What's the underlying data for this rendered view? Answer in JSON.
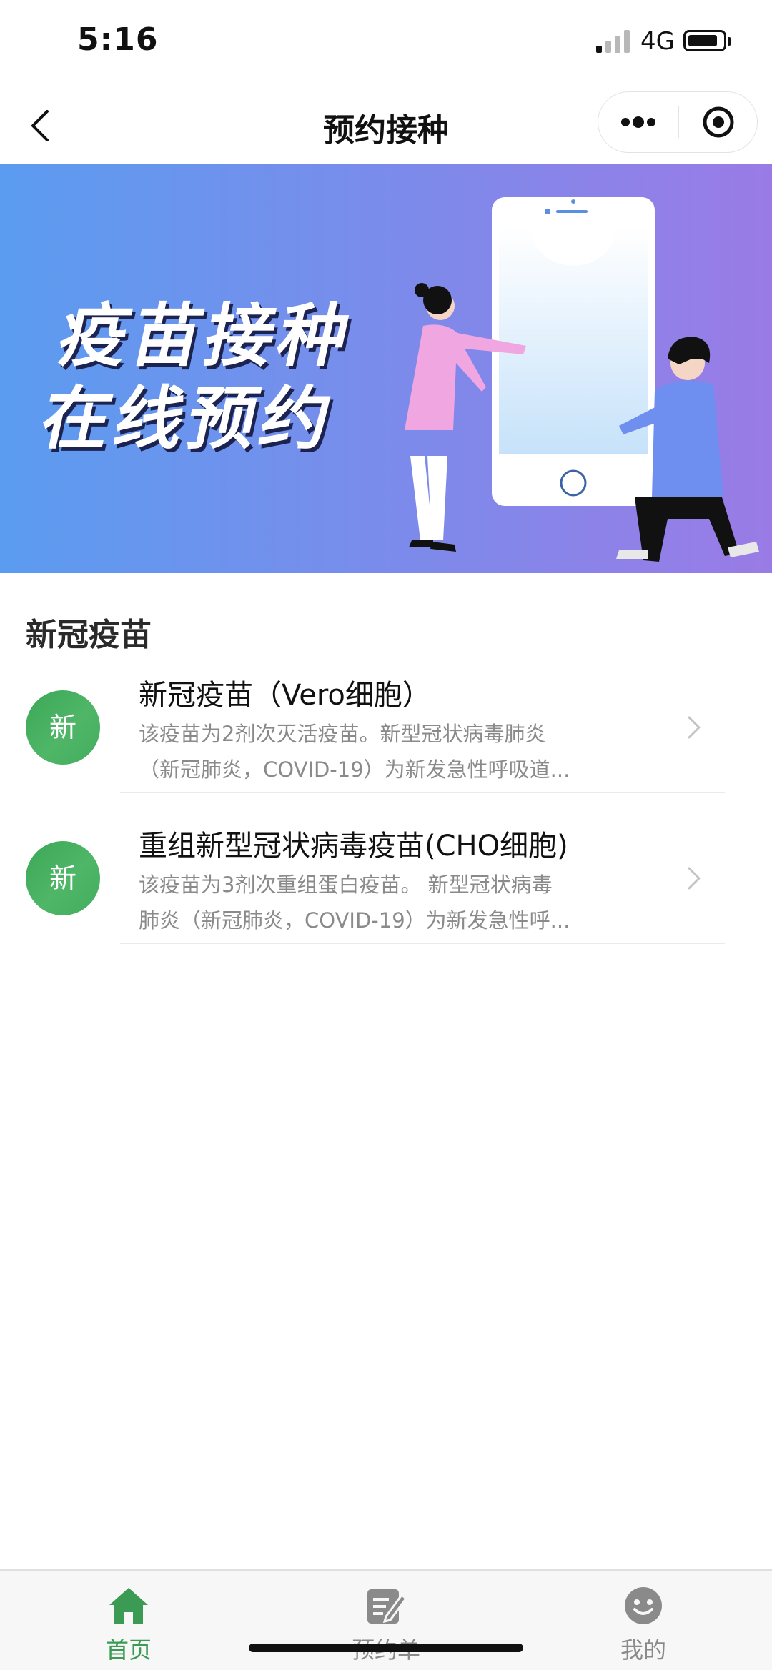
{
  "status_bar": {
    "time": "5:16",
    "network": "4G"
  },
  "nav": {
    "title": "预约接种"
  },
  "banner": {
    "line1": "疫苗接种",
    "line2": "在线预约"
  },
  "section": {
    "title": "新冠疫苗"
  },
  "vaccines": [
    {
      "badge": "新",
      "title": "新冠疫苗（Vero细胞）",
      "desc_line1": "该疫苗为2剂次灭活疫苗。新型冠状病毒肺炎",
      "desc_line2": "（新冠肺炎，COVID-19）为新发急性呼吸道..."
    },
    {
      "badge": "新",
      "title": "重组新型冠状病毒疫苗(CHO细胞)",
      "desc_line1": "该疫苗为3剂次重组蛋白疫苗。 新型冠状病毒",
      "desc_line2": "肺炎（新冠肺炎，COVID-19）为新发急性呼..."
    }
  ],
  "tabs": [
    {
      "label": "首页",
      "icon": "home-icon",
      "active": true
    },
    {
      "label": "预约单",
      "icon": "edit-document-icon",
      "active": false
    },
    {
      "label": "我的",
      "icon": "smile-face-icon",
      "active": false
    }
  ],
  "colors": {
    "accent_green": "#3b9a54",
    "badge_green": "#43ad5e",
    "banner_blue": "#5b9cf0",
    "banner_purple": "#9a7be6"
  }
}
